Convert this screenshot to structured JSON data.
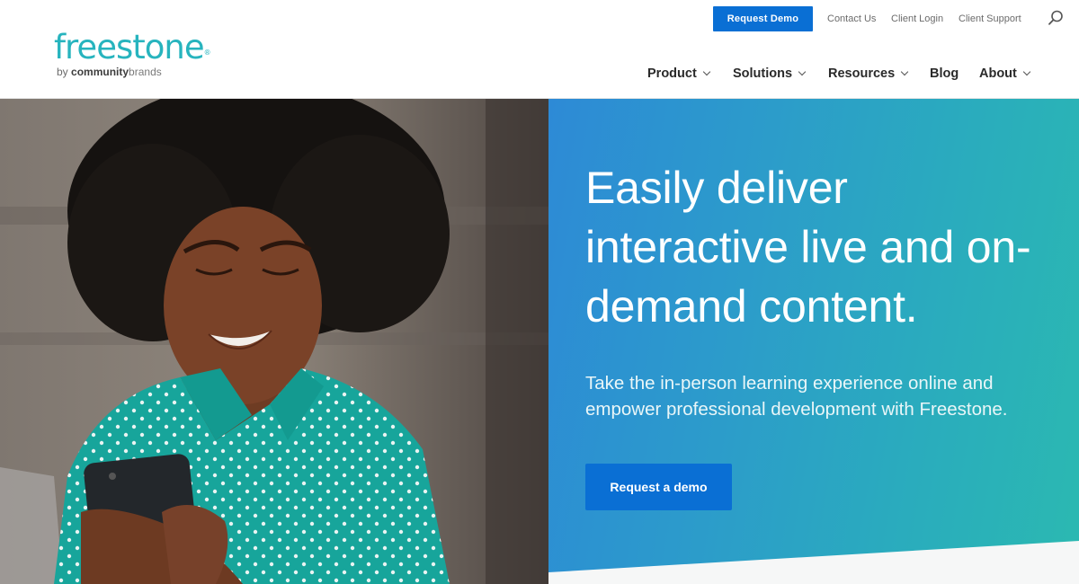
{
  "brand": {
    "name": "freestone",
    "registered_mark": "®",
    "byline_prefix": "by",
    "byline_bold": "community",
    "byline_rest": "brands",
    "color": "#27b4be"
  },
  "utility_nav": {
    "cta_label": "Request Demo",
    "links": [
      "Contact Us",
      "Client Login",
      "Client Support"
    ],
    "search_icon": "search-icon"
  },
  "main_nav": {
    "items": [
      {
        "label": "Product",
        "has_dropdown": true
      },
      {
        "label": "Solutions",
        "has_dropdown": true
      },
      {
        "label": "Resources",
        "has_dropdown": true
      },
      {
        "label": "Blog",
        "has_dropdown": false
      },
      {
        "label": "About",
        "has_dropdown": true
      }
    ]
  },
  "hero": {
    "title_lines": [
      "Easily deliver",
      "interactive live and on-",
      "demand content."
    ],
    "subtitle_lines": [
      "Take the in-person learning experience online and",
      "empower professional development with Freestone."
    ],
    "cta_label": "Request a demo",
    "image_alt": "Smiling woman in teal polka-dot shirt looking at smartphone",
    "gradient_start": "#2d8ad6",
    "gradient_end": "#2bb9b1",
    "accent": "#0a6fd4"
  }
}
